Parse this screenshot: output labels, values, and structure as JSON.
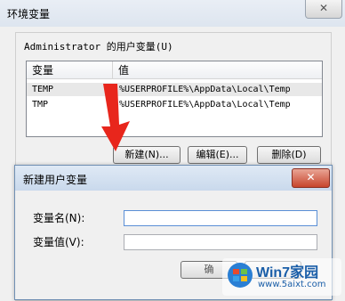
{
  "env_dialog": {
    "title": "环境变量",
    "close_glyph": "✕",
    "user_group_label": "Administrator 的用户变量(U)",
    "table": {
      "columns": [
        "变量",
        "值"
      ],
      "rows": [
        {
          "name": "TEMP",
          "value": "%USERPROFILE%\\AppData\\Local\\Temp",
          "selected": true
        },
        {
          "name": "TMP",
          "value": "%USERPROFILE%\\AppData\\Local\\Temp",
          "selected": false
        }
      ]
    },
    "buttons": {
      "new": "新建(N)...",
      "edit": "编辑(E)...",
      "delete": "删除(D)"
    }
  },
  "new_var_dialog": {
    "title": "新建用户变量",
    "close_glyph": "✕",
    "name_label": "变量名(N):",
    "value_label": "变量值(V):",
    "name_value": "",
    "value_value": "",
    "ok_label": "确",
    "cancel_label": ""
  },
  "watermark": {
    "title": "Win7家园",
    "url": "www.5aixt.com"
  },
  "colors": {
    "arrow": "#e8261c",
    "close_red": "#c7452d",
    "selection": "#e8e8e8"
  }
}
